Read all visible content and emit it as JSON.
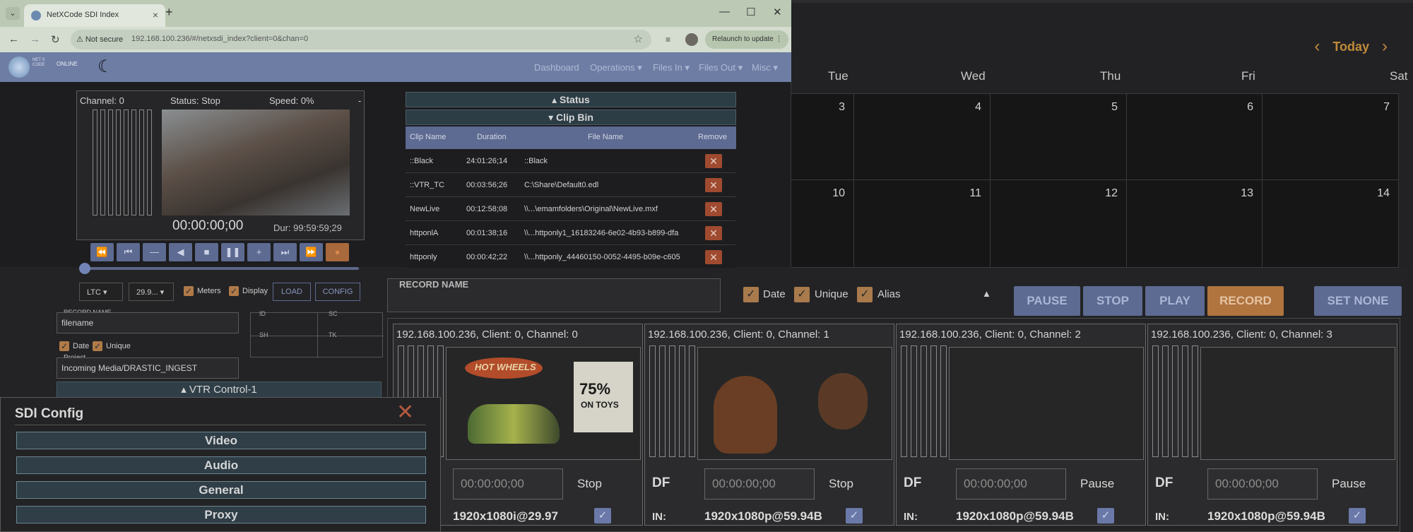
{
  "calendar": {
    "nav": {
      "today_label": "Today"
    },
    "days": [
      "Tue",
      "Wed",
      "Thu",
      "Fri",
      "Sat"
    ],
    "week1": [
      "3",
      "4",
      "5",
      "6",
      "7"
    ],
    "week2": [
      "10",
      "11",
      "12",
      "13",
      "14"
    ]
  },
  "browser": {
    "tab_title": "NetXCode SDI Index",
    "not_secure": "Not secure",
    "url": "192.168.100.236/#/netxsdi_index?client=0&chan=0",
    "relaunch_label": "Relaunch to update"
  },
  "app": {
    "logo_text": "NET X CODE",
    "online_label": "ONLINE",
    "menu": [
      "Dashboard",
      "Operations ▾",
      "Files In ▾",
      "Files Out ▾",
      "Misc ▾"
    ]
  },
  "player": {
    "channel": "Channel: 0",
    "status": "Status: Stop",
    "speed": "Speed: 0%",
    "dash": "-",
    "timecode": "00:00:00;00",
    "duration": "Dur: 99:59:59;29"
  },
  "controls": {
    "ltc": "LTC",
    "fps": "29.9...",
    "meters": "Meters",
    "display": "Display",
    "load": "LOAD",
    "config": "CONFIG",
    "record_name_label": "RECORD NAME",
    "record_name_value": "filename",
    "date": "Date",
    "unique": "Unique",
    "project_label": "Project",
    "project_value": "Incoming Media/DRASTIC_INGEST",
    "id": "ID",
    "sc": "SC",
    "sh": "SH",
    "tk": "TK",
    "vtr_control": "▴ VTR Control-1"
  },
  "status_bar": "▴ Status",
  "clip_bin": {
    "title": "▾ Clip Bin",
    "headers": [
      "Clip Name",
      "Duration",
      "File Name",
      "Remove"
    ],
    "rows": [
      {
        "name": "::Black",
        "duration": "24:01:26;14",
        "file": "::Black"
      },
      {
        "name": "::VTR_TC",
        "duration": "00:03:56;26",
        "file": "C:\\Share\\Default0.edl"
      },
      {
        "name": "NewLive",
        "duration": "00:12:58;08",
        "file": "\\\\...\\emamfolders\\Original\\NewLive.mxf"
      },
      {
        "name": "httponlA",
        "duration": "00:01:38;16",
        "file": "\\\\...httponly1_16183246-6e02-4b93-b899-dfa"
      },
      {
        "name": "httponly",
        "duration": "00:00:42;22",
        "file": "\\\\...httponly_44460150-0052-4495-b09e-c605"
      }
    ],
    "remove_glyph": "✕"
  },
  "record": {
    "record_name_label": "RECORD NAME",
    "date": "Date",
    "unique": "Unique",
    "alias": "Alias",
    "collapse": "▲",
    "pause": "PAUSE",
    "stop": "STOP",
    "play": "PLAY",
    "record": "RECORD",
    "set_none": "SET NONE"
  },
  "channels": [
    {
      "title": "192.168.100.236, Client: 0, Channel: 0",
      "df": "",
      "tc": "00:00:00;00",
      "state": "Stop",
      "in": "",
      "format": "1920x1080i@29.97"
    },
    {
      "title": "192.168.100.236, Client: 0, Channel: 1",
      "df": "DF",
      "tc": "00:00:00;00",
      "state": "Stop",
      "in": "IN:",
      "format": "1920x1080p@59.94B"
    },
    {
      "title": "192.168.100.236, Client: 0, Channel: 2",
      "df": "DF",
      "tc": "00:00:00;00",
      "state": "Pause",
      "in": "IN:",
      "format": "1920x1080p@59.94B"
    },
    {
      "title": "192.168.100.236, Client: 0, Channel: 3",
      "df": "DF",
      "tc": "00:00:00;00",
      "state": "Pause",
      "in": "IN:",
      "format": "1920x1080p@59.94B"
    }
  ],
  "thumb": {
    "hotwheels": "HOT WHEELS",
    "poster_big": "75%",
    "poster_small": "ON TOYS"
  },
  "sdi_config": {
    "title": "SDI Config",
    "close": "✕",
    "buttons": [
      "Video",
      "Audio",
      "General",
      "Proxy"
    ]
  },
  "icons": {
    "check": "✓"
  }
}
